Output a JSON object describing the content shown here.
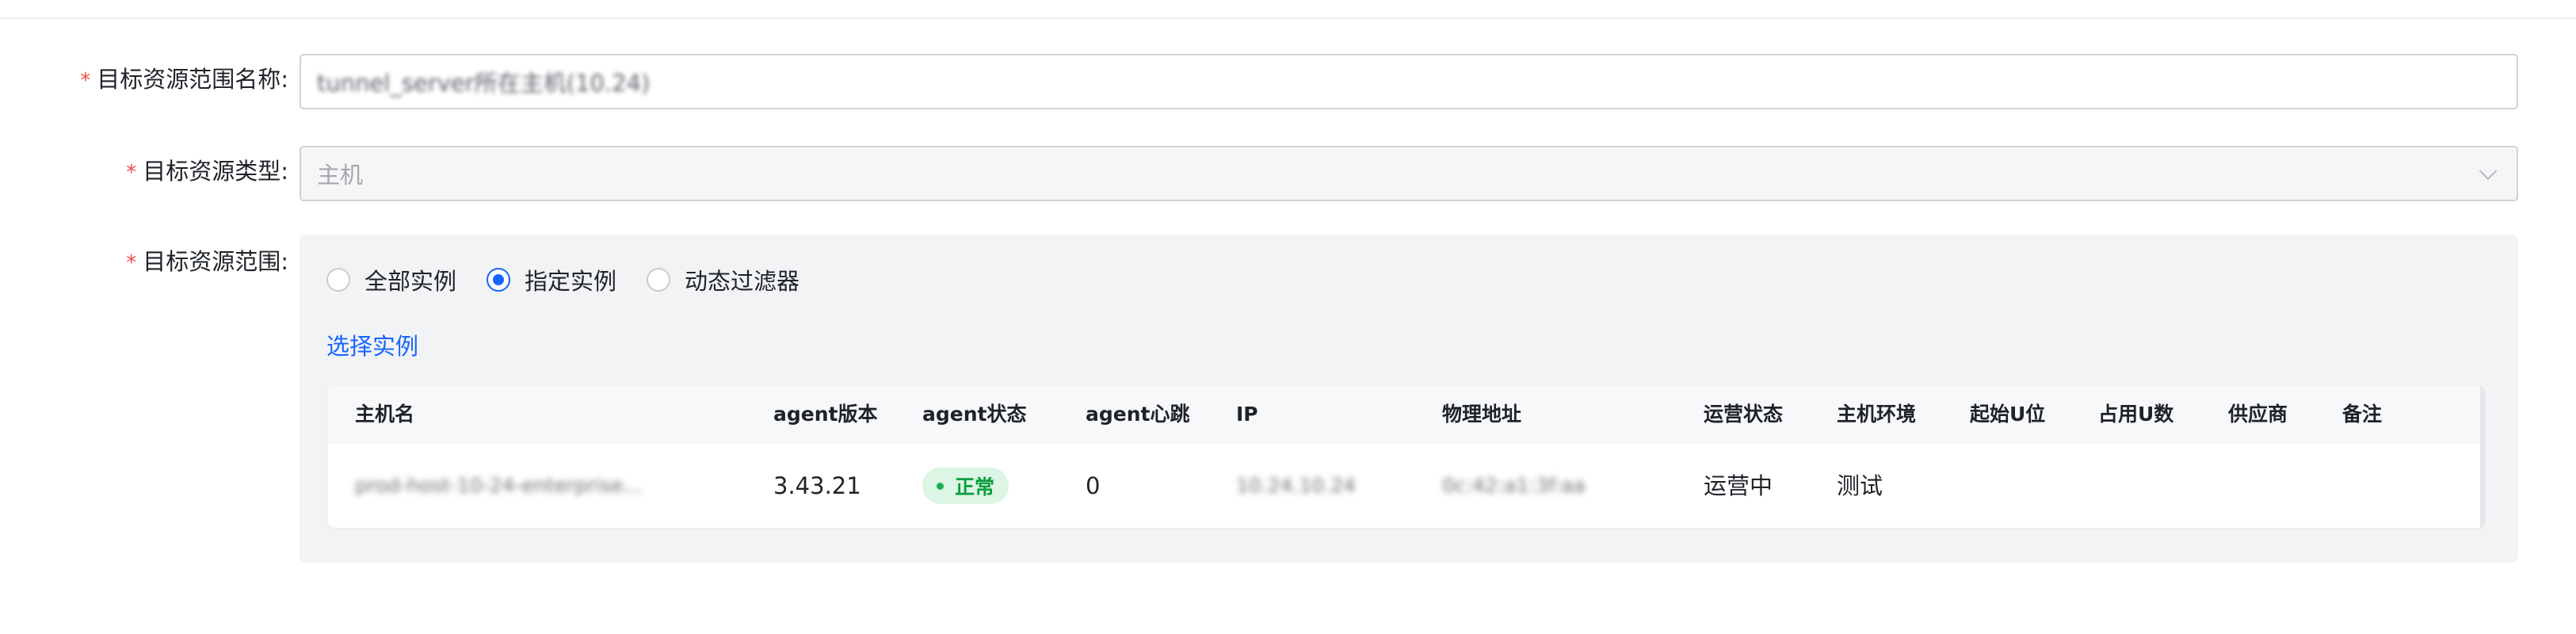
{
  "form": {
    "name_label": "目标资源范围名称:",
    "name_value": "tunnel_server所在主机(10.24)",
    "type_label": "目标资源类型:",
    "type_value": "主机",
    "scope_label": "目标资源范围:"
  },
  "scope": {
    "options": [
      {
        "label": "全部实例",
        "checked": false
      },
      {
        "label": "指定实例",
        "checked": true
      },
      {
        "label": "动态过滤器",
        "checked": false
      }
    ],
    "select_link": "选择实例"
  },
  "table": {
    "columns": [
      "主机名",
      "agent版本",
      "agent状态",
      "agent心跳",
      "IP",
      "物理地址",
      "运营状态",
      "主机环境",
      "起始U位",
      "占用U数",
      "供应商",
      "备注"
    ],
    "rows": [
      {
        "hostname": "prod-host-10-24-enterprise...",
        "agent_version": "3.43.21",
        "agent_status": "正常",
        "agent_heartbeat": "0",
        "ip": "10.24.10.24",
        "physical_address": "0c:42:a1:3f:aa",
        "ops_status": "运营中",
        "environment": "测试",
        "start_u": "",
        "u_count": "",
        "vendor": "",
        "remark": ""
      }
    ]
  },
  "colors": {
    "accent": "#1664ff",
    "required": "#f54a45",
    "status_ok_bg": "#dcf5e4",
    "status_ok_text": "#0a9e3d"
  }
}
